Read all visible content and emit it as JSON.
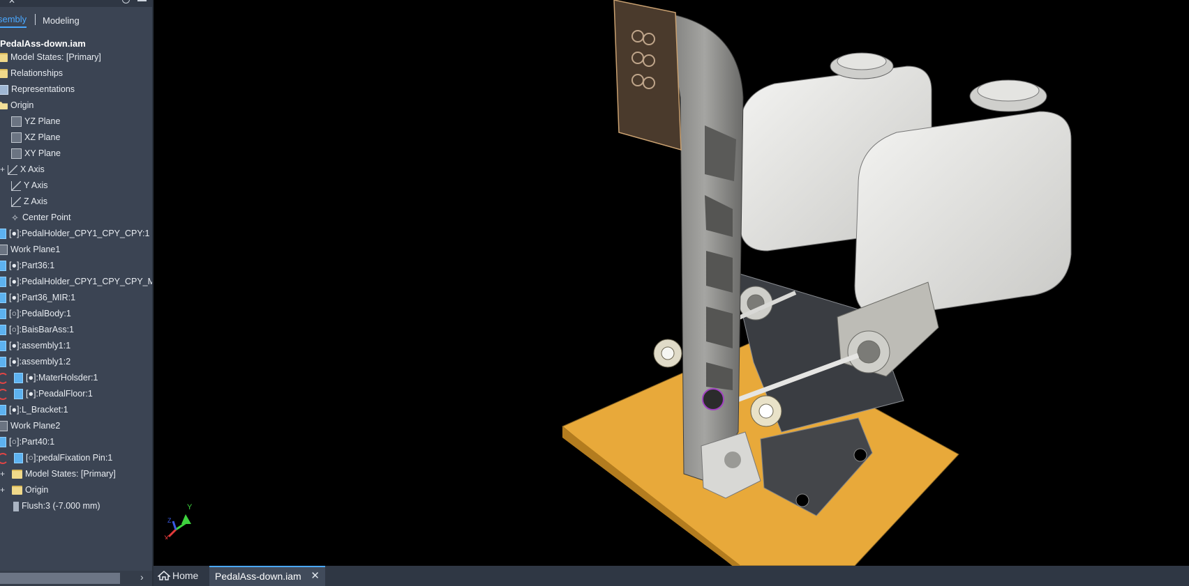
{
  "browser": {
    "tabs": {
      "assembly": "sembly",
      "modeling": "Modeling"
    },
    "root": "PedalAss-down.iam",
    "items": [
      {
        "label": "Model States: [Primary]",
        "icon": "folder-icon"
      },
      {
        "label": "Relationships",
        "icon": "folder-icon"
      },
      {
        "label": "Representations",
        "icon": "representations-icon"
      },
      {
        "label": "Origin",
        "icon": "folder-open-icon"
      },
      {
        "label": "YZ Plane",
        "icon": "plane-icon"
      },
      {
        "label": "XZ Plane",
        "icon": "plane-icon"
      },
      {
        "label": "XY Plane",
        "icon": "plane-icon"
      },
      {
        "label": "X Axis",
        "icon": "axis-icon"
      },
      {
        "label": "Y Axis",
        "icon": "axis-icon"
      },
      {
        "label": "Z Axis",
        "icon": "axis-icon"
      },
      {
        "label": "Center Point",
        "icon": "point-icon"
      },
      {
        "label": "[●]:PedalHolder_CPY1_CPY_CPY:1",
        "icon": "part-icon"
      },
      {
        "label": "Work Plane1",
        "icon": "plane-icon"
      },
      {
        "label": "[●]:Part36:1",
        "icon": "part-icon"
      },
      {
        "label": "[●]:PedalHolder_CPY1_CPY_CPY_M",
        "icon": "part-icon"
      },
      {
        "label": "[●]:Part36_MIR:1",
        "icon": "part-icon"
      },
      {
        "label": "[○]:PedalBody:1",
        "icon": "part-icon"
      },
      {
        "label": "[○]:BaisBarAss:1",
        "icon": "assembly-icon"
      },
      {
        "label": "[●]:assembly1:1",
        "icon": "assembly-icon"
      },
      {
        "label": "[●]:assembly1:2",
        "icon": "assembly-icon"
      },
      {
        "label": "[●]:MaterHolsder:1",
        "icon": "part-icon"
      },
      {
        "label": "[●]:PeadalFloor:1",
        "icon": "part-icon"
      },
      {
        "label": "[●]:L_Bracket:1",
        "icon": "part-icon"
      },
      {
        "label": "Work Plane2",
        "icon": "plane-icon"
      },
      {
        "label": "[○]:Part40:1",
        "icon": "part-icon"
      },
      {
        "label": "[○]:pedalFixation Pin:1",
        "icon": "part-icon"
      },
      {
        "label": "Model States: [Primary]",
        "icon": "folder-icon"
      },
      {
        "label": "Origin",
        "icon": "folder-icon"
      },
      {
        "label": "Flush:3 (-7.000 mm)",
        "icon": "flush-icon"
      }
    ]
  },
  "doc_tabs": {
    "home": "Home",
    "active": "PedalAss-down.iam",
    "close": "✕"
  },
  "triad": {
    "x": "X",
    "y": "Y",
    "z": "Z"
  },
  "colors": {
    "base_plate": "#e8a93a",
    "reservoir": "#e9e9e6",
    "pedal": "#8c8c8a",
    "pad": "#4a3a2c",
    "accent": "#4aa8ff"
  }
}
